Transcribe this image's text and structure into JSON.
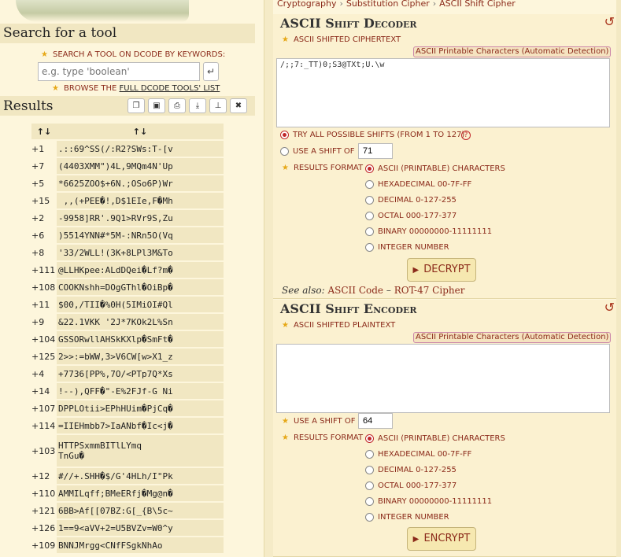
{
  "left": {
    "search_heading": "Search for a tool",
    "search_label": "SEARCH A TOOL ON DCODE BY KEYWORDS:",
    "search_placeholder": "e.g. type 'boolean'",
    "browse_prefix": "BROWSE THE",
    "browse_link": "FULL DCODE TOOLS' LIST",
    "results_title": "Results",
    "table_headers": [
      "↑↓",
      "↑↓"
    ],
    "rows": [
      {
        "shift": "+1",
        "text": ".::69^SS(/:R2?SWs:T-[v"
      },
      {
        "shift": "+7",
        "text": "(4403XMM\")4L,9MQm4N'Up"
      },
      {
        "shift": "+5",
        "text": "*6625ZOO$+6N.;OSo6P)Wr"
      },
      {
        "shift": "+15",
        "text": " ,,(+PEE�!,D$1EIe,F�Mh"
      },
      {
        "shift": "+2",
        "text": "-9958]RR'.9Q1>RVr9S,Zu"
      },
      {
        "shift": "+6",
        "text": ")5514YNN#*5M-:NRn5O(Vq"
      },
      {
        "shift": "+8",
        "text": "'33/2WLL!(3K+8LPl3M&To"
      },
      {
        "shift": "+111",
        "text": "@LLHKpee:ALdDQei�Lf?m�"
      },
      {
        "shift": "+108",
        "text": "COOKNshh=DOgGThl�OiBp�"
      },
      {
        "shift": "+11",
        "text": "$00,/TII�%0H(5IMiOI#Ql"
      },
      {
        "shift": "+9",
        "text": "&22.1VKK '2J*7KOk2L%Sn"
      },
      {
        "shift": "+104",
        "text": "GSSORwllAHSkKXlp�SmFt�"
      },
      {
        "shift": "+125",
        "text": "2>>:=bWW,3>V6CW[w>X1_z"
      },
      {
        "shift": "+4",
        "text": "+7736[PP%,7O/<PTp7Q*Xs"
      },
      {
        "shift": "+14",
        "text": "!--),QFF�\"-E%2FJf-G Ni"
      },
      {
        "shift": "+107",
        "text": "DPPLOtii>EPhHUim�PjCq�"
      },
      {
        "shift": "+114",
        "text": "=IIEHmbb7>IaANbf�Ic<j�"
      },
      {
        "shift": "+103",
        "text": "HTTPSxmmBITlLYmq\nTnGu�",
        "tall": true
      },
      {
        "shift": "+12",
        "text": "#//+.SHH�$/G'4HLh/I\"Pk"
      },
      {
        "shift": "+110",
        "text": "AMMILqff;BMeERfj�Mg@n�"
      },
      {
        "shift": "+121",
        "text": "6BB>Af[[07BZ:G[_{B\\5c~"
      },
      {
        "shift": "+126",
        "text": "1==9<aVV+2=U5BVZv=W0^y"
      },
      {
        "shift": "+109",
        "text": "BNNJMrgg<CNfFSgkNhAo"
      }
    ]
  },
  "breadcrumb": [
    "Cryptography",
    "Substitution Cipher",
    "ASCII Shift Cipher"
  ],
  "decoder": {
    "title": "ASCII Shift Decoder",
    "field_label": "ASCII SHIFTED CIPHERTEXT",
    "detect_badge": "ASCII Printable Characters (Automatic Detection)",
    "ciphertext": "/;;7:_TT)0;S3@TXt;U.\\w",
    "try_all": "TRY ALL POSSIBLE SHIFTS (FROM 1 TO 127)",
    "use_shift": "USE A SHIFT OF",
    "shift_value": "71",
    "results_format": "RESULTS FORMAT",
    "formats": [
      "ASCII (PRINTABLE) CHARACTERS",
      "HEXADECIMAL 00-7F-FF",
      "DECIMAL 0-127-255",
      "OCTAL 000-177-377",
      "BINARY 00000000-11111111",
      "INTEGER NUMBER"
    ],
    "button": "DECRYPT",
    "see_also_prefix": "See also:",
    "see_also_1": "ASCII Code",
    "see_also_sep": "–",
    "see_also_2": "ROT-47 Cipher"
  },
  "encoder": {
    "title": "ASCII Shift Encoder",
    "field_label": "ASCII SHIFTED PLAINTEXT",
    "detect_badge": "ASCII Printable Characters (Automatic Detection)",
    "plaintext": "",
    "use_shift": "USE A SHIFT OF",
    "shift_value": "64",
    "results_format": "RESULTS FORMAT",
    "formats": [
      "ASCII (PRINTABLE) CHARACTERS",
      "HEXADECIMAL 00-7F-FF",
      "DECIMAL 0-127-255",
      "OCTAL 000-177-377",
      "BINARY 00000000-11111111",
      "INTEGER NUMBER"
    ],
    "button": "ENCRYPT"
  }
}
